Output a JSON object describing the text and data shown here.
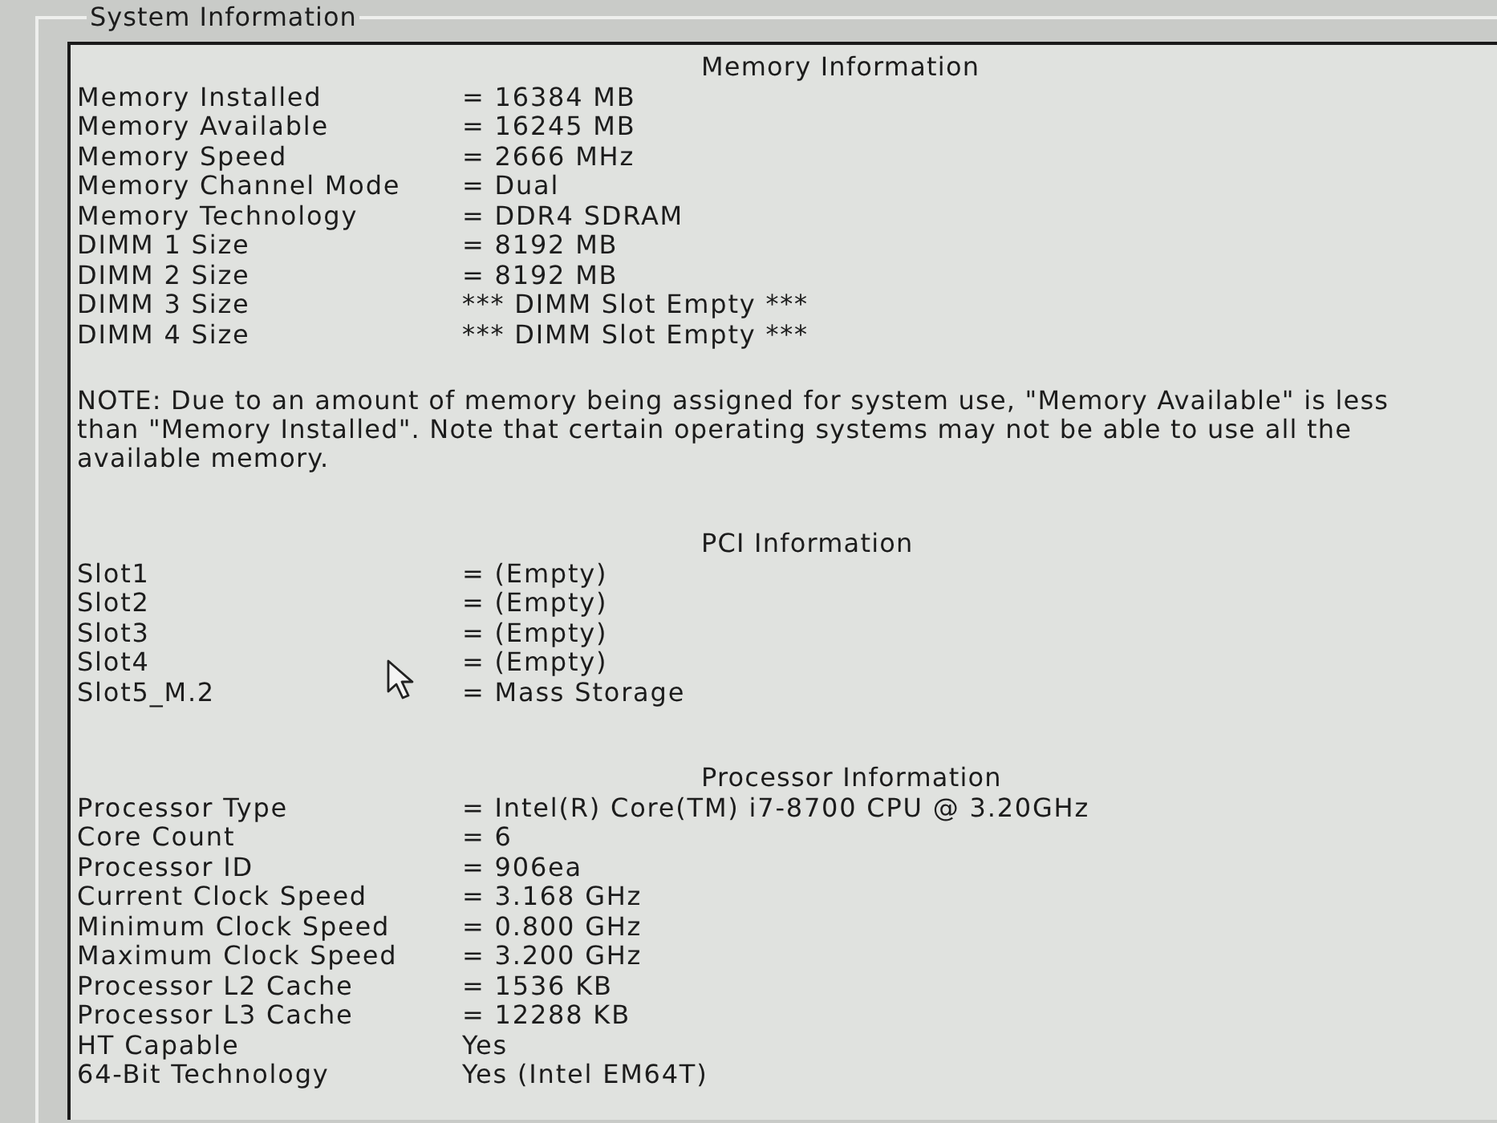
{
  "group_box": {
    "title": "System Information"
  },
  "sections": [
    {
      "title": "Memory Information",
      "rows": [
        {
          "label": "Memory Installed",
          "value": "= 16384 MB"
        },
        {
          "label": "Memory Available",
          "value": "= 16245 MB"
        },
        {
          "label": "Memory Speed",
          "value": "= 2666 MHz"
        },
        {
          "label": "Memory Channel Mode",
          "value": "= Dual"
        },
        {
          "label": "Memory Technology",
          "value": "= DDR4 SDRAM"
        },
        {
          "label": "DIMM 1 Size",
          "value": "= 8192 MB"
        },
        {
          "label": "DIMM 2 Size",
          "value": "= 8192 MB"
        },
        {
          "label": "DIMM 3 Size",
          "value": "*** DIMM Slot Empty ***"
        },
        {
          "label": "DIMM 4 Size",
          "value": "*** DIMM Slot Empty ***"
        }
      ],
      "note": "NOTE: Due to an amount of memory being assigned for system use, \"Memory Available\" is less than \"Memory Installed\". Note that certain operating systems may not be able to use all the available memory."
    },
    {
      "title": "PCI Information",
      "rows": [
        {
          "label": "Slot1",
          "value": "= (Empty)"
        },
        {
          "label": "Slot2",
          "value": "= (Empty)"
        },
        {
          "label": "Slot3",
          "value": "= (Empty)"
        },
        {
          "label": "Slot4",
          "value": "= (Empty)"
        },
        {
          "label": "Slot5_M.2",
          "value": "= Mass Storage"
        }
      ]
    },
    {
      "title": "Processor Information",
      "rows": [
        {
          "label": "Processor Type",
          "value": "= Intel(R) Core(TM) i7-8700 CPU @ 3.20GHz"
        },
        {
          "label": "Core Count",
          "value": "= 6"
        },
        {
          "label": "Processor ID",
          "value": "= 906ea"
        },
        {
          "label": "Current Clock Speed",
          "value": "= 3.168 GHz"
        },
        {
          "label": "Minimum Clock Speed",
          "value": "= 0.800 GHz"
        },
        {
          "label": "Maximum Clock Speed",
          "value": "= 3.200 GHz"
        },
        {
          "label": "Processor L2 Cache",
          "value": "= 1536 KB"
        },
        {
          "label": "Processor L3 Cache",
          "value": "= 12288 KB"
        },
        {
          "label": "HT Capable",
          "value": "Yes"
        },
        {
          "label": "64-Bit Technology",
          "value": "Yes (Intel EM64T)"
        }
      ]
    }
  ]
}
